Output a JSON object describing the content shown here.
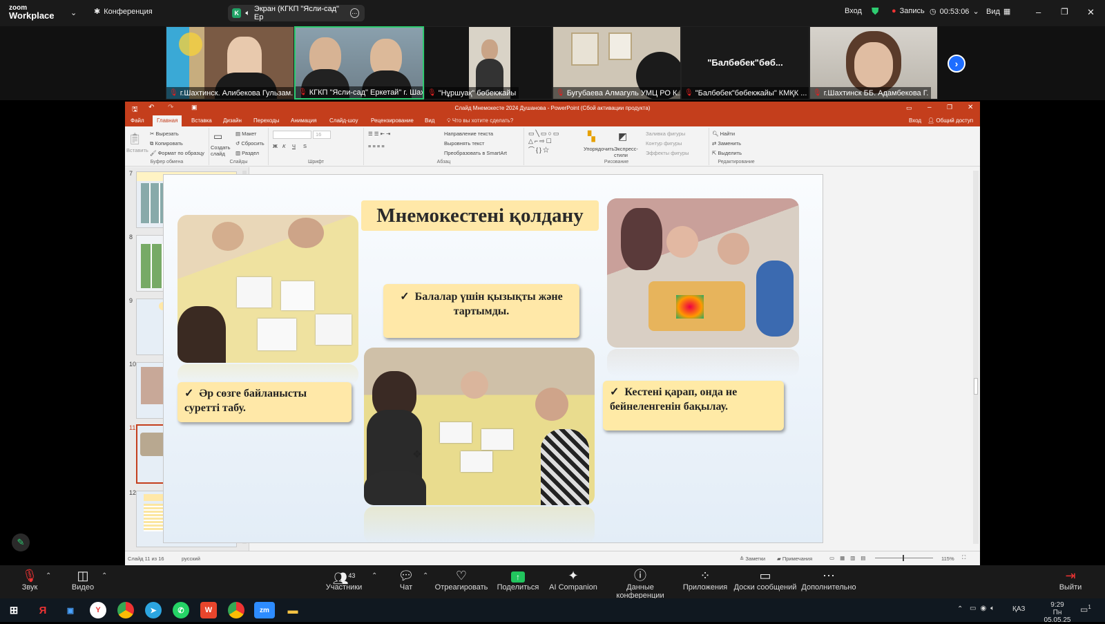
{
  "zoom": {
    "brand_top": "zoom",
    "brand_bottom": "Workplace",
    "meeting_label": "Конференция",
    "share_label": "Экран (КГКП \"Ясли-сад\" Ер",
    "signin": "Вход",
    "record": "Запись",
    "timer": "00:53:06",
    "view": "Вид"
  },
  "participants": [
    {
      "name": "г.Шахтинск. Алибекова Гульзам..."
    },
    {
      "name": "КГКП \"Ясли-сад\" Еркетай\" г. Шахт..."
    },
    {
      "name": "\"Нұршуақ\" бөбекжайы"
    },
    {
      "name": "Бугубаева Алмагуль УМЦ РО К..."
    },
    {
      "name": "\"Балбөбек\"бөбекжайы\" КМҚК ...",
      "placeholder": "\"Балбөбек\"бөб..."
    },
    {
      "name": "г.Шахтинск ББ. Адамбекова Г."
    }
  ],
  "ppt": {
    "title": "Слайд Мнемокесте 2024 Душанова - PowerPoint (Сбой активации продукта)",
    "tabs": [
      "Файл",
      "Главная",
      "Вставка",
      "Дизайн",
      "Переходы",
      "Анимация",
      "Слайд-шоу",
      "Рецензирование",
      "Вид"
    ],
    "tell_me": "Что вы хотите сделать?",
    "signin": "Вход",
    "share": "Общий доступ",
    "ribbon": {
      "paste": "Вставить",
      "cut": "Вырезать",
      "copy": "Копировать",
      "format_painter": "Формат по образцу",
      "clipboard": "Буфер обмена",
      "new_slide": "Создать слайд",
      "layout": "Макет",
      "reset": "Сбросить",
      "section": "Раздел",
      "slides": "Слайды",
      "font_size": "16",
      "font": "Шрифт",
      "text_direction": "Направление текста",
      "align_text": "Выровнять текст",
      "smartart": "Преобразовать в SmartArt",
      "paragraph": "Абзац",
      "arrange": "Упорядочить",
      "quick_styles": "Экспресс-стили",
      "shape_fill": "Заливка фигуры",
      "shape_outline": "Контур фигуры",
      "shape_effects": "Эффекты фигуры",
      "drawing": "Рисование",
      "find": "Найти",
      "replace": "Заменить",
      "select": "Выделить",
      "editing": "Редактирование"
    },
    "thumbs": [
      "7",
      "8",
      "9",
      "10",
      "11",
      "12"
    ],
    "slide": {
      "title": "Мнемокестені қолдану",
      "box_center": "Балалар үшін қызықты және тартымды.",
      "box_left": "Әр сөзге байланысты суретті табу.",
      "box_right": "Кестені қарап, онда не бейнеленгенін бақылау.",
      "check": "✓"
    },
    "status": {
      "slide_of": "Слайд 11 из 16",
      "lang": "русский",
      "notes": "Заметки",
      "comments": "Примечания",
      "zoom": "115%"
    }
  },
  "toolbar": [
    {
      "label": "Звук",
      "icon": "mic-muted-icon"
    },
    {
      "label": "Видео",
      "icon": "video-icon"
    },
    {
      "label": "Участники",
      "icon": "participants-icon",
      "count": "43"
    },
    {
      "label": "Чат",
      "icon": "chat-icon"
    },
    {
      "label": "Отреагировать",
      "icon": "heart-icon"
    },
    {
      "label": "Поделиться",
      "icon": "share-icon"
    },
    {
      "label": "AI Companion",
      "icon": "sparkle-icon"
    },
    {
      "label": "Данные конференции",
      "icon": "info-icon"
    },
    {
      "label": "Приложения",
      "icon": "apps-icon"
    },
    {
      "label": "Доски сообщений",
      "icon": "whiteboard-icon"
    },
    {
      "label": "Дополнительно",
      "icon": "more-icon"
    },
    {
      "label": "Выйти",
      "icon": "exit-icon"
    }
  ],
  "taskbar": {
    "lang": "ҚАЗ",
    "time": "9:29",
    "date": "Пн 05.05.25",
    "notif": "1"
  }
}
